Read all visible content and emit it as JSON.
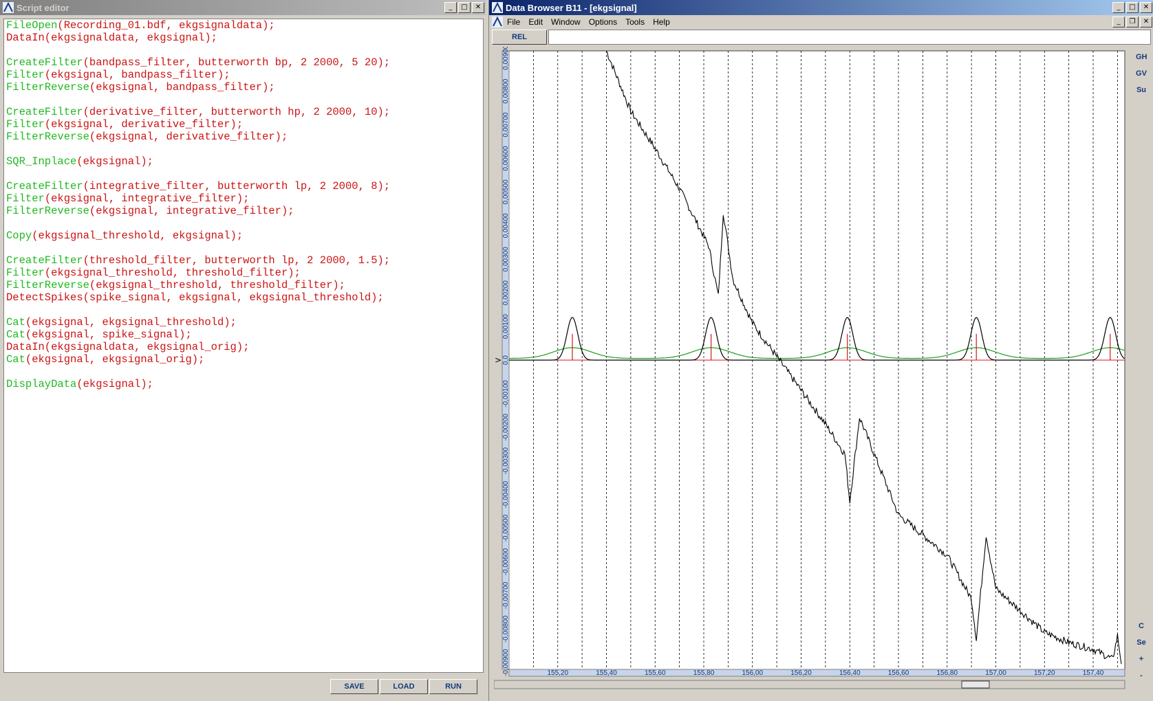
{
  "script_editor": {
    "title": "Script editor",
    "lines": [
      [
        {
          "t": "FileOpen",
          "c": "fn"
        },
        {
          "t": "(Recording_01.bdf, ekgsignaldata);",
          "c": "tx"
        }
      ],
      [
        {
          "t": "DataIn(ekgsignaldata, ekgsignal);",
          "c": "tx"
        }
      ],
      [],
      [
        {
          "t": "CreateFilter",
          "c": "fn"
        },
        {
          "t": "(bandpass_filter, butterworth bp, 2 2000, 5 20);",
          "c": "tx"
        }
      ],
      [
        {
          "t": "Filter",
          "c": "fn"
        },
        {
          "t": "(ekgsignal, bandpass_filter);",
          "c": "tx"
        }
      ],
      [
        {
          "t": "FilterReverse",
          "c": "fn"
        },
        {
          "t": "(ekgsignal, bandpass_filter);",
          "c": "tx"
        }
      ],
      [],
      [
        {
          "t": "CreateFilter",
          "c": "fn"
        },
        {
          "t": "(derivative_filter, butterworth hp, 2 2000, 10);",
          "c": "tx"
        }
      ],
      [
        {
          "t": "Filter",
          "c": "fn"
        },
        {
          "t": "(ekgsignal, derivative_filter);",
          "c": "tx"
        }
      ],
      [
        {
          "t": "FilterReverse",
          "c": "fn"
        },
        {
          "t": "(ekgsignal, derivative_filter);",
          "c": "tx"
        }
      ],
      [],
      [
        {
          "t": "SQR_Inplace",
          "c": "fn"
        },
        {
          "t": "(ekgsignal);",
          "c": "tx"
        }
      ],
      [],
      [
        {
          "t": "CreateFilter",
          "c": "fn"
        },
        {
          "t": "(integrative_filter, butterworth lp, 2 2000, 8);",
          "c": "tx"
        }
      ],
      [
        {
          "t": "Filter",
          "c": "fn"
        },
        {
          "t": "(ekgsignal, integrative_filter);",
          "c": "tx"
        }
      ],
      [
        {
          "t": "FilterReverse",
          "c": "fn"
        },
        {
          "t": "(ekgsignal, integrative_filter);",
          "c": "tx"
        }
      ],
      [],
      [
        {
          "t": "Copy",
          "c": "fn"
        },
        {
          "t": "(ekgsignal_threshold, ekgsignal);",
          "c": "tx"
        }
      ],
      [],
      [
        {
          "t": "CreateFilter",
          "c": "fn"
        },
        {
          "t": "(threshold_filter, butterworth lp, 2 2000, 1.5);",
          "c": "tx"
        }
      ],
      [
        {
          "t": "Filter",
          "c": "fn"
        },
        {
          "t": "(ekgsignal_threshold, threshold_filter);",
          "c": "tx"
        }
      ],
      [
        {
          "t": "FilterReverse",
          "c": "fn"
        },
        {
          "t": "(ekgsignal_threshold, threshold_filter);",
          "c": "tx"
        }
      ],
      [
        {
          "t": "DetectSpikes(spike_signal, ekgsignal, ekgsignal_threshold);",
          "c": "tx"
        }
      ],
      [],
      [
        {
          "t": "Cat",
          "c": "fn"
        },
        {
          "t": "(ekgsignal, ekgsignal_threshold);",
          "c": "tx"
        }
      ],
      [
        {
          "t": "Cat",
          "c": "fn"
        },
        {
          "t": "(ekgsignal, spike_signal);",
          "c": "tx"
        }
      ],
      [
        {
          "t": "DataIn(ekgsignaldata, ekgsignal_orig);",
          "c": "tx"
        }
      ],
      [
        {
          "t": "Cat",
          "c": "fn"
        },
        {
          "t": "(ekgsignal, ekgsignal_orig);",
          "c": "tx"
        }
      ],
      [],
      [
        {
          "t": "DisplayData",
          "c": "fn"
        },
        {
          "t": "(ekgsignal);",
          "c": "tx"
        }
      ]
    ],
    "buttons": {
      "save": "SAVE",
      "load": "LOAD",
      "run": "RUN"
    }
  },
  "data_browser": {
    "title": "Data Browser B11 - [ekgsignal]",
    "menu": [
      "File",
      "Edit",
      "Window",
      "Options",
      "Tools",
      "Help"
    ],
    "rel_button": "REL",
    "side_buttons_top": [
      "GH",
      "GV",
      "Su"
    ],
    "side_buttons_bottom": [
      "C",
      "Se",
      "+",
      "-"
    ],
    "hscroll_buttons": [
      "+",
      "-"
    ]
  },
  "chart_data": {
    "type": "line",
    "x_ticks": [
      "155,20",
      "155,40",
      "155,60",
      "155,80",
      "156,00",
      "156,20",
      "156,40",
      "156,60",
      "156,80",
      "157,00",
      "157,20",
      "157,40"
    ],
    "y_ticks": [
      "0,00900",
      "0,00800",
      "0,00700",
      "0,00600",
      "0,00500",
      "0,00400",
      "0,00300",
      "0,00200",
      "0,00100",
      "0,0",
      "-0,00100",
      "-0,00200",
      "-0,00300",
      "-0,00400",
      "-0,00500",
      "-0,00600",
      "-0,00700",
      "-0,00800",
      "-0,00900"
    ],
    "xlim": [
      155.0,
      157.53
    ],
    "ylim": [
      -0.0092,
      0.0092
    ],
    "grid": "vertical dashed",
    "colors": {
      "raw": "#000000",
      "threshold": "#18a018",
      "spikes": "#d01818",
      "energy": "#000000"
    },
    "series": [
      {
        "values_desc": "raw ekg",
        "x": [
          155.4,
          155.5,
          155.6,
          155.7,
          155.82,
          155.86,
          155.88,
          155.92,
          156.0,
          156.2,
          156.3,
          156.38,
          156.4,
          156.44,
          156.6,
          156.7,
          156.8,
          156.9,
          156.92,
          156.96,
          157.0,
          157.2,
          157.3,
          157.4,
          157.48,
          157.5,
          157.52
        ],
        "y": [
          0.0092,
          0.0074,
          0.0063,
          0.0051,
          0.0034,
          0.0019,
          0.0044,
          0.0024,
          0.0011,
          -0.0009,
          -0.0019,
          -0.0028,
          -0.0042,
          -0.0017,
          -0.0046,
          -0.0052,
          -0.0058,
          -0.0071,
          -0.0083,
          -0.0052,
          -0.0068,
          -0.0081,
          -0.0084,
          -0.0086,
          -0.0089,
          -0.0082,
          -0.0092
        ]
      },
      {
        "values_desc": "energy",
        "peaks": [
          155.26,
          155.83,
          156.39,
          156.92,
          157.47
        ],
        "peak_height": 0.00127,
        "width": 0.045
      },
      {
        "values_desc": "threshold",
        "peaks": [
          155.26,
          155.83,
          156.39,
          156.92,
          157.47
        ],
        "peak_height": 0.00032,
        "base": 5e-05
      },
      {
        "values_desc": "spikes",
        "x": [
          155.26,
          155.83,
          156.39,
          156.92,
          157.47
        ],
        "height": 0.00078
      }
    ]
  }
}
